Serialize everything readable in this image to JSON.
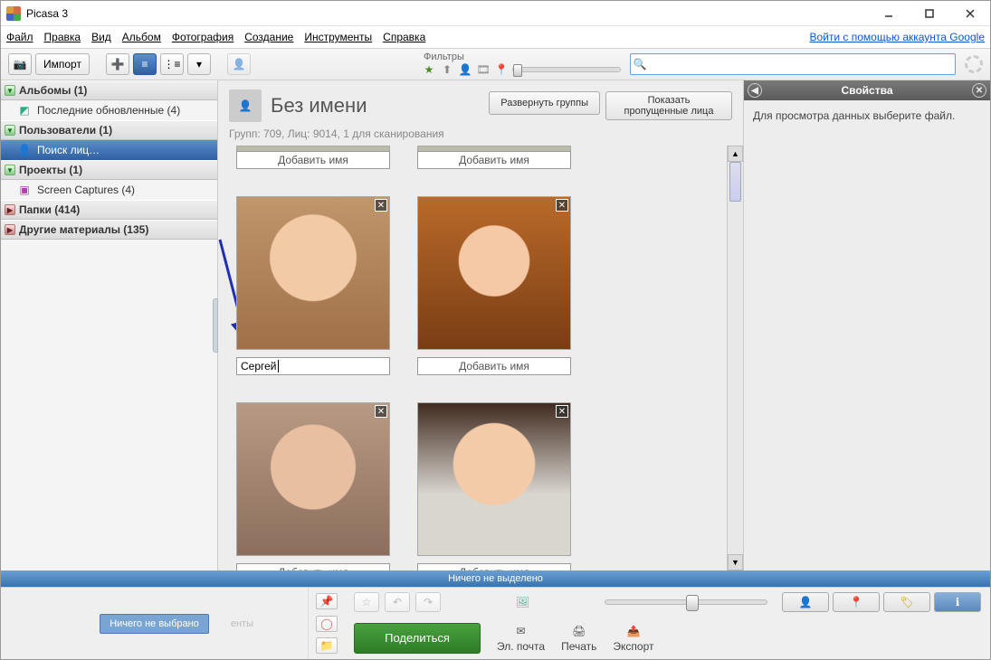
{
  "window": {
    "title": "Picasa 3"
  },
  "menu": {
    "file": "Файл",
    "edit": "Правка",
    "view": "Вид",
    "album": "Альбом",
    "photo": "Фотография",
    "create": "Создание",
    "tools": "Инструменты",
    "help": "Справка",
    "signin": "Войти с помощью аккаунта Google"
  },
  "toolbar": {
    "import": "Импорт",
    "filters_label": "Фильтры"
  },
  "sidebar": {
    "albums": {
      "head": "Альбомы (1)",
      "item1": "Последние обновленные (4)"
    },
    "users": {
      "head": "Пользователи (1)",
      "item1": "Поиск лиц…"
    },
    "projects": {
      "head": "Проекты (1)",
      "item1": "Screen Captures (4)"
    },
    "folders": {
      "head": "Папки (414)"
    },
    "other": {
      "head": "Другие материалы (135)"
    }
  },
  "people": {
    "title": "Без имени",
    "expand": "Развернуть группы",
    "showskipped": "Показать пропущенные лица",
    "stats": "Групп: 709, Лиц: 9014, 1 для сканирования",
    "addname": "Добавить имя",
    "typed": "Сергей"
  },
  "properties": {
    "title": "Свойства",
    "body": "Для просмотра данных выберите файл."
  },
  "status": {
    "blue": "Ничего не выделено"
  },
  "footer": {
    "chip": "Ничего не выбрано",
    "ghost": "енты",
    "share": "Поделиться",
    "email": "Эл. почта",
    "print": "Печать",
    "export": "Экспорт"
  }
}
